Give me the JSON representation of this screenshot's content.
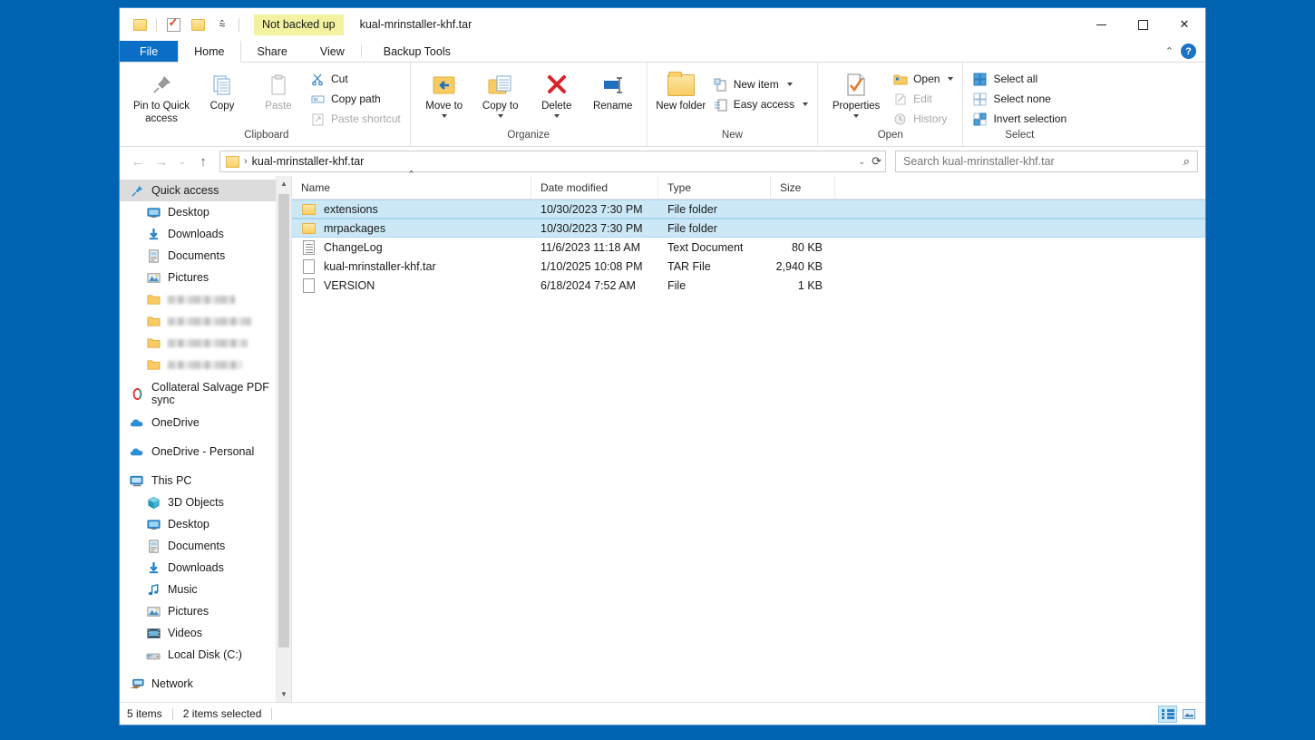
{
  "window": {
    "title": "kual-mrinstaller-khf.tar",
    "backup_badge": "Not backed up",
    "controls": {
      "minimize": "minimize",
      "maximize": "maximize",
      "close": "close"
    }
  },
  "quick_access_toolbar": [
    {
      "name": "new-folder-qat",
      "icon": "folder-icon"
    },
    {
      "name": "properties-qat",
      "icon": "properties-icon"
    },
    {
      "name": "recent-folder-qat",
      "icon": "folder-icon"
    },
    {
      "name": "customize-qat",
      "icon": "chevron-down-icon"
    }
  ],
  "tabs": [
    {
      "label": "File",
      "active": false,
      "kind": "file"
    },
    {
      "label": "Home",
      "active": true,
      "kind": "normal"
    },
    {
      "label": "Share",
      "active": false,
      "kind": "normal"
    },
    {
      "label": "View",
      "active": false,
      "kind": "normal"
    },
    {
      "label": "Backup Tools",
      "active": false,
      "kind": "context"
    }
  ],
  "ribbon": {
    "collapse_icon": "chevron-up-icon",
    "help_label": "?",
    "groups": [
      {
        "label": "Clipboard",
        "big_buttons": [
          {
            "label": "Pin to Quick access",
            "icon": "pin-icon",
            "disabled": false
          },
          {
            "label": "Copy",
            "icon": "copy-icon",
            "disabled": false
          },
          {
            "label": "Paste",
            "icon": "paste-icon",
            "disabled": true
          }
        ],
        "small_buttons": [
          {
            "label": "Cut",
            "icon": "scissors-icon",
            "disabled": false
          },
          {
            "label": "Copy path",
            "icon": "copy-path-icon",
            "disabled": false
          },
          {
            "label": "Paste shortcut",
            "icon": "paste-shortcut-icon",
            "disabled": true
          }
        ]
      },
      {
        "label": "Organize",
        "big_buttons": [
          {
            "label": "Move to",
            "icon": "move-to-icon",
            "has_caret": true
          },
          {
            "label": "Copy to",
            "icon": "copy-to-icon",
            "has_caret": true
          },
          {
            "label": "Delete",
            "icon": "delete-icon",
            "has_caret": true
          },
          {
            "label": "Rename",
            "icon": "rename-icon",
            "has_caret": false
          }
        ]
      },
      {
        "label": "New",
        "big_buttons": [
          {
            "label": "New folder",
            "icon": "new-folder-icon",
            "has_caret": false
          }
        ],
        "small_buttons": [
          {
            "label": "New item",
            "icon": "new-item-icon",
            "has_caret": true
          },
          {
            "label": "Easy access",
            "icon": "easy-access-icon",
            "has_caret": true
          }
        ]
      },
      {
        "label": "Open",
        "big_buttons": [
          {
            "label": "Properties",
            "icon": "properties-icon",
            "has_caret": true
          }
        ],
        "small_buttons": [
          {
            "label": "Open",
            "icon": "open-folder-icon",
            "has_caret": true,
            "disabled": false
          },
          {
            "label": "Edit",
            "icon": "edit-icon",
            "disabled": true
          },
          {
            "label": "History",
            "icon": "history-icon",
            "disabled": true
          }
        ]
      },
      {
        "label": "Select",
        "small_buttons": [
          {
            "label": "Select all",
            "icon": "select-all-icon"
          },
          {
            "label": "Select none",
            "icon": "select-none-icon"
          },
          {
            "label": "Invert selection",
            "icon": "invert-selection-icon"
          }
        ]
      }
    ]
  },
  "address_bar": {
    "back_icon": "arrow-left-icon",
    "forward_icon": "arrow-right-icon",
    "recent_icon": "chevron-down-icon",
    "up_icon": "arrow-up-icon",
    "path_icon": "folder-icon",
    "path": "kual-mrinstaller-khf.tar",
    "dropdown_icon": "chevron-down-icon",
    "refresh_icon": "refresh-icon"
  },
  "search": {
    "placeholder": "Search kual-mrinstaller-khf.tar",
    "value": "",
    "icon": "search-icon"
  },
  "sidebar": {
    "items": [
      {
        "label": "Quick access",
        "icon": "pin-star-icon",
        "level": 0,
        "selected": true,
        "pinned": false
      },
      {
        "label": "Desktop",
        "icon": "desktop-icon",
        "level": 1,
        "pinned": true
      },
      {
        "label": "Downloads",
        "icon": "download-icon",
        "level": 1,
        "pinned": true
      },
      {
        "label": "Documents",
        "icon": "documents-icon",
        "level": 1,
        "pinned": true
      },
      {
        "label": "Pictures",
        "icon": "pictures-icon",
        "level": 1,
        "pinned": true
      },
      {
        "label": "",
        "icon": "folder-icon",
        "level": 1,
        "blurred": true
      },
      {
        "label": "",
        "icon": "folder-icon",
        "level": 1,
        "blurred": true
      },
      {
        "label": "",
        "icon": "folder-icon",
        "level": 1,
        "blurred": true
      },
      {
        "label": "",
        "icon": "folder-icon",
        "level": 1,
        "blurred": true
      },
      {
        "label": "Collateral Salvage PDF sync",
        "icon": "sync-ring-icon",
        "level": 0,
        "spaced": true
      },
      {
        "label": "OneDrive",
        "icon": "cloud-icon",
        "level": 0,
        "spaced": true
      },
      {
        "label": "OneDrive - Personal",
        "icon": "cloud-icon",
        "level": 0,
        "spaced": true
      },
      {
        "label": "This PC",
        "icon": "this-pc-icon",
        "level": 0,
        "spaced": true
      },
      {
        "label": "3D Objects",
        "icon": "3d-objects-icon",
        "level": 1
      },
      {
        "label": "Desktop",
        "icon": "desktop-icon",
        "level": 1
      },
      {
        "label": "Documents",
        "icon": "documents-icon",
        "level": 1
      },
      {
        "label": "Downloads",
        "icon": "download-icon",
        "level": 1
      },
      {
        "label": "Music",
        "icon": "music-icon",
        "level": 1
      },
      {
        "label": "Pictures",
        "icon": "pictures-icon",
        "level": 1
      },
      {
        "label": "Videos",
        "icon": "videos-icon",
        "level": 1
      },
      {
        "label": "Local Disk (C:)",
        "icon": "disk-icon",
        "level": 1
      },
      {
        "label": "Network",
        "icon": "network-icon",
        "level": 0,
        "spaced": true
      }
    ]
  },
  "file_list": {
    "columns": [
      {
        "label": "Name",
        "sorted": true,
        "sort_dir": "asc"
      },
      {
        "label": "Date modified",
        "sorted": false
      },
      {
        "label": "Type",
        "sorted": false
      },
      {
        "label": "Size",
        "sorted": false
      }
    ],
    "rows": [
      {
        "name": "extensions",
        "date": "10/30/2023 7:30 PM",
        "type": "File folder",
        "size": "",
        "icon": "folder-icon",
        "selected": true
      },
      {
        "name": "mrpackages",
        "date": "10/30/2023 7:30 PM",
        "type": "File folder",
        "size": "",
        "icon": "folder-icon",
        "selected": true
      },
      {
        "name": "ChangeLog",
        "date": "11/6/2023 11:18 AM",
        "type": "Text Document",
        "size": "80 KB",
        "icon": "text-document-icon",
        "selected": false
      },
      {
        "name": "kual-mrinstaller-khf.tar",
        "date": "1/10/2025 10:08 PM",
        "type": "TAR File",
        "size": "2,940 KB",
        "icon": "file-icon",
        "selected": false
      },
      {
        "name": "VERSION",
        "date": "6/18/2024 7:52 AM",
        "type": "File",
        "size": "1 KB",
        "icon": "file-icon",
        "selected": false
      }
    ]
  },
  "status_bar": {
    "item_count": "5 items",
    "selection": "2 items selected",
    "views": [
      {
        "name": "details-view-button",
        "icon": "details-view-icon",
        "active": true
      },
      {
        "name": "large-icons-view-button",
        "icon": "large-icons-view-icon",
        "active": false
      }
    ]
  },
  "colors": {
    "desktop": "#0063b1",
    "accent": "#0b6ec6",
    "selection": "#cce8f7",
    "badge": "#f2f2a0",
    "folder": "#fcd163"
  }
}
